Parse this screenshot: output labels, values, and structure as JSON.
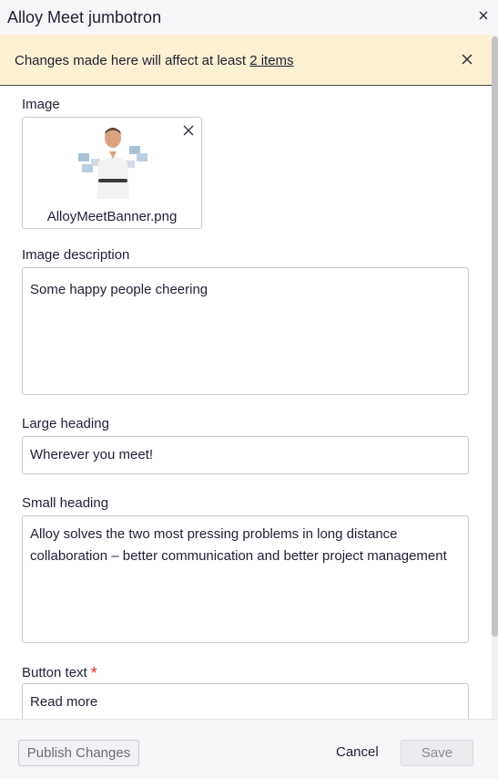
{
  "dialog": {
    "title": "Alloy Meet jumbotron"
  },
  "banner": {
    "text": "Changes made here will affect at least ",
    "link_text": "2 items"
  },
  "fields": {
    "image": {
      "label": "Image",
      "filename": "AlloyMeetBanner.png"
    },
    "image_description": {
      "label": "Image description",
      "value": "Some happy people cheering"
    },
    "large_heading": {
      "label": "Large heading",
      "value": "Wherever you meet!"
    },
    "small_heading": {
      "label": "Small heading",
      "value": "Alloy solves the two most pressing problems in long distance collaboration – better communication and better project management"
    },
    "button_text": {
      "label": "Button text",
      "required_mark": "*",
      "value": "Read more"
    }
  },
  "footer": {
    "publish_label": "Publish Changes",
    "cancel_label": "Cancel",
    "save_label": "Save"
  },
  "colors": {
    "banner_bg": "#fcf0d3",
    "required": "#e0312a",
    "text": "#1f2033"
  }
}
